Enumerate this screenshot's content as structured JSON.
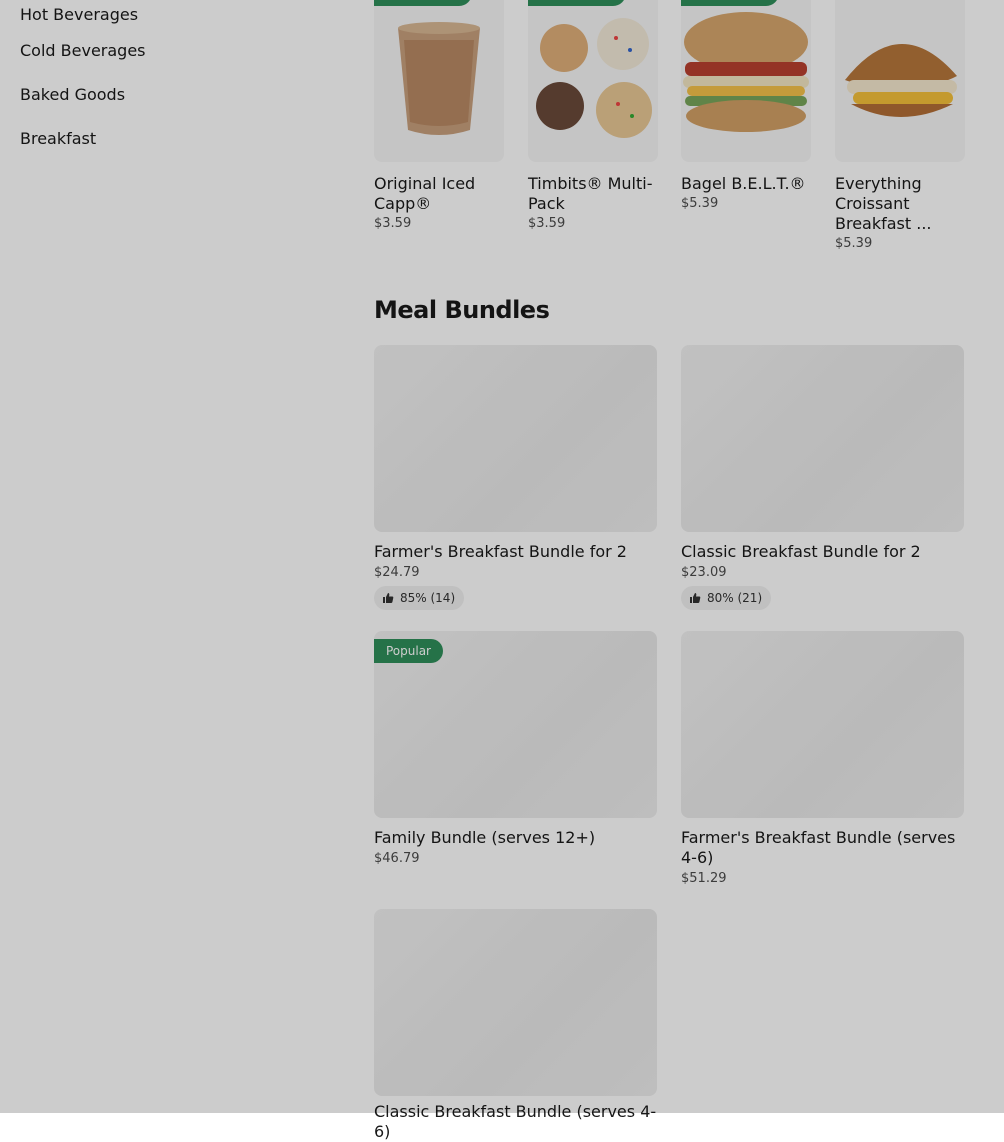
{
  "sidebar": {
    "items": [
      {
        "label": "Hot Beverages"
      },
      {
        "label": "Cold Beverages"
      },
      {
        "label": "Baked Goods"
      },
      {
        "label": "Breakfast"
      }
    ]
  },
  "carousel": {
    "items": [
      {
        "name": "Original Iced Capp®",
        "price": "$3.59"
      },
      {
        "name": "Timbits® Multi-Pack",
        "price": "$3.59"
      },
      {
        "name": "Bagel B.E.L.T.®",
        "price": "$5.39"
      },
      {
        "name": "Everything Croissant Breakfast ...",
        "price": "$5.39"
      }
    ]
  },
  "meal_bundles": {
    "title": "Meal Bundles",
    "items": [
      {
        "name": "Farmer's Breakfast Bundle for 2",
        "price": "$24.79",
        "rating": "85% (14)"
      },
      {
        "name": "Classic Breakfast Bundle for 2",
        "price": "$23.09",
        "rating": "80% (21)"
      },
      {
        "name": "Family Bundle (serves 12+)",
        "price": "$46.79",
        "badge": "Popular"
      },
      {
        "name": "Farmer's Breakfast Bundle (serves 4-6)",
        "price": "$51.29"
      },
      {
        "name": "Classic Breakfast Bundle (serves 4-6)"
      }
    ]
  },
  "colors": {
    "accent": "#2f8f5a",
    "overlay": "rgba(0,0,0,0.2)"
  }
}
